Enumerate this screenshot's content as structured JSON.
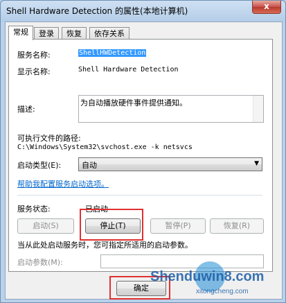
{
  "window": {
    "title": "Shell Hardware Detection 的属性(本地计算机)",
    "close_glyph": "x"
  },
  "tabs": [
    {
      "label": "常规",
      "active": true
    },
    {
      "label": "登录",
      "active": false
    },
    {
      "label": "恢复",
      "active": false
    },
    {
      "label": "依存关系",
      "active": false
    }
  ],
  "general": {
    "service_name_label": "服务名称:",
    "service_name_value": "ShellHWDetection",
    "display_name_label": "显示名称:",
    "display_name_value": "Shell Hardware Detection",
    "description_label": "描述:",
    "description_value": "为自动播放硬件事件提供通知。",
    "exec_path_label": "可执行文件的路径:",
    "exec_path_value": "C:\\Windows\\System32\\svchost.exe -k netsvcs",
    "startup_type_label": "启动类型(E):",
    "startup_type_value": "自动",
    "help_link": "帮助我配置服务启动选项。",
    "service_status_label": "服务状态:",
    "service_status_value": "已启动",
    "buttons": {
      "start": "启动(S)",
      "stop": "停止(T)",
      "pause": "暂停(P)",
      "resume": "恢复(R)"
    },
    "hint_text": "当从此处启动服务时，您可指定所适用的启动参数。",
    "start_params_label": "启动参数(M):",
    "start_params_value": ""
  },
  "footer": {
    "ok_label": "确定"
  },
  "watermark": {
    "site": "Shenduwin8.com",
    "sub": "xitongcheng.com"
  },
  "colors": {
    "highlight_box": "#e03030",
    "selection": "#3399ff",
    "link": "#0066cc"
  }
}
